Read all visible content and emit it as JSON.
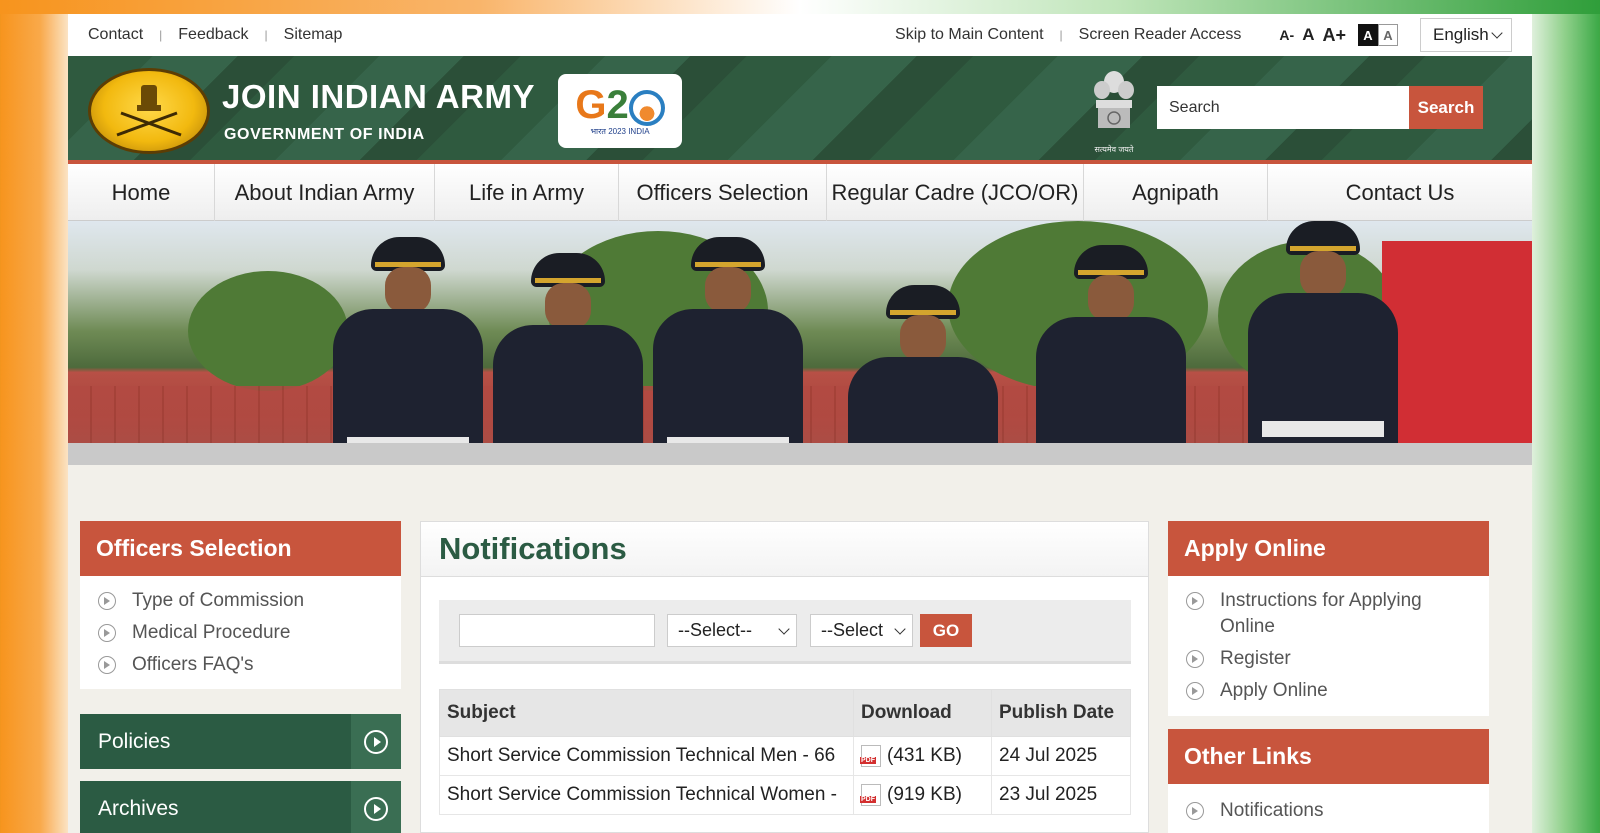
{
  "utility": {
    "contact": "Contact",
    "feedback": "Feedback",
    "sitemap": "Sitemap",
    "skip": "Skip to Main Content",
    "screen_reader": "Screen Reader Access",
    "font_small": "A-",
    "font_normal": "A",
    "font_large": "A+",
    "contrast_dark": "A",
    "contrast_light": "A",
    "language": "English"
  },
  "header": {
    "title": "JOIN INDIAN ARMY",
    "subtitle": "GOVERNMENT OF INDIA",
    "g20_tag": "भारत 2023 INDIA",
    "motto": "सत्यमेव जयते",
    "search_placeholder": "Search",
    "search_button": "Search"
  },
  "nav": [
    "Home",
    "About Indian Army",
    "Life in Army",
    "Officers Selection",
    "Regular Cadre (JCO/OR)",
    "Agnipath",
    "Contact Us"
  ],
  "officers": {
    "title": "Officers Selection",
    "items": [
      "Type of Commission",
      "Medical Procedure",
      "Officers FAQ's"
    ]
  },
  "sidebar_bars": [
    "Policies",
    "Archives"
  ],
  "notifications": {
    "title": "Notifications",
    "select1": "--Select--",
    "select2": "--Select",
    "go": "GO",
    "columns": [
      "Subject",
      "Download",
      "Publish Date"
    ],
    "rows": [
      {
        "subject": "Short Service Commission Technical Men - 66",
        "size": "(431 KB)",
        "date": "24 Jul 2025"
      },
      {
        "subject": "Short Service Commission Technical Women -",
        "size": "(919 KB)",
        "date": "23 Jul 2025"
      }
    ]
  },
  "apply": {
    "title": "Apply Online",
    "items": [
      "Instructions for Applying Online",
      "Register",
      "Apply Online"
    ]
  },
  "other_links": {
    "title": "Other Links",
    "items": [
      "Notifications"
    ]
  },
  "colors": {
    "accent": "#c8553d",
    "green": "#2b5b43"
  }
}
